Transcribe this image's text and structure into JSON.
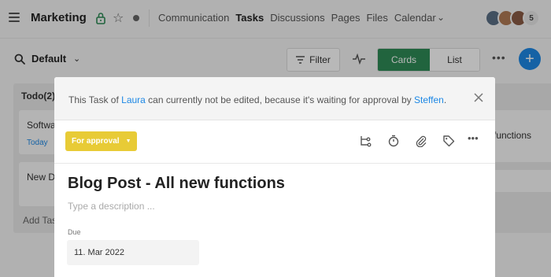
{
  "header": {
    "space_title": "Marketing",
    "nav": [
      "Communication",
      "Tasks",
      "Discussions",
      "Pages",
      "Files",
      "Calendar"
    ],
    "active_nav": "Tasks",
    "member_count": "5",
    "avatar_colors": [
      "#5a6f86",
      "#b07a55",
      "#8a5a44"
    ]
  },
  "toolbar": {
    "view_label": "Default",
    "filter_label": "Filter",
    "cards_label": "Cards",
    "list_label": "List",
    "add_label": "+"
  },
  "board": {
    "column_title": "Todo(2)",
    "card1_title": "Softwa",
    "card1_due": "Today",
    "card2_title": "New D",
    "add_task": "Add Tas",
    "right_card_title": "functions"
  },
  "modal": {
    "notice_pre": "This Task of ",
    "notice_user": "Laura",
    "notice_mid": " can currently not be edited, because it's waiting for approval by ",
    "notice_approver": "Steffen",
    "notice_post": ".",
    "status_label": "For approval",
    "task_title": "Blog Post - All new functions",
    "description_placeholder": "Type a description ...",
    "due_label": "Due",
    "due_value": "11. Mar 2022"
  },
  "colors": {
    "accent_green": "#2e8b57",
    "accent_blue": "#1e88e5",
    "status_yellow": "#e8cb36"
  }
}
